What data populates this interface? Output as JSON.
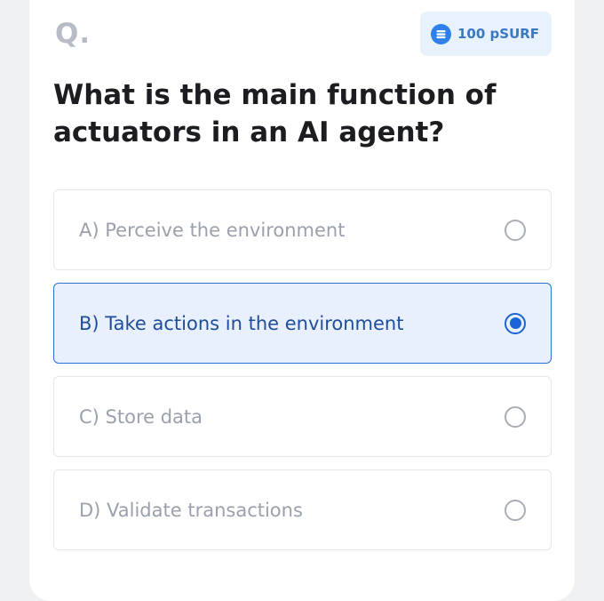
{
  "question_marker": "Q.",
  "reward": {
    "icon": "stack-coin-icon",
    "label": "100 pSURF"
  },
  "question_text": "What is the main function of actuators in an AI agent?",
  "options": [
    {
      "label": "A) Perceive the environment",
      "selected": false
    },
    {
      "label": "B) Take actions in the environment",
      "selected": true
    },
    {
      "label": "C) Store data",
      "selected": false
    },
    {
      "label": "D) Validate transactions",
      "selected": false
    }
  ],
  "colors": {
    "accent": "#1a64d8",
    "selected_bg": "#e8f0fd",
    "badge_bg": "#e8f2fc"
  }
}
